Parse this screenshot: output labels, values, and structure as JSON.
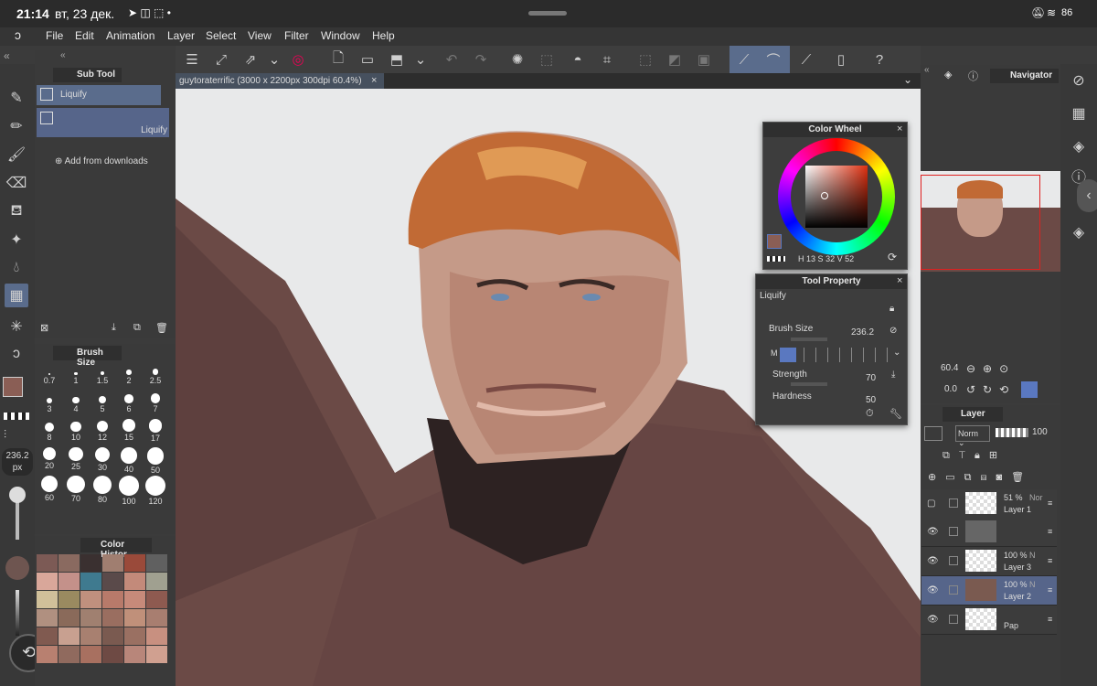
{
  "status": {
    "time": "21:14",
    "date": "вт, 23 дек.",
    "battery": "86"
  },
  "menu": [
    "File",
    "Edit",
    "Animation",
    "Layer",
    "Select",
    "View",
    "Filter",
    "Window",
    "Help"
  ],
  "subtool": {
    "title": "Sub Tool",
    "items": [
      "Liquify",
      "Liquify"
    ],
    "add": "Add from downloads"
  },
  "brush": {
    "title": "Brush Size",
    "sizes": [
      "0.7",
      "1",
      "1.5",
      "2",
      "2.5",
      "3",
      "4",
      "5",
      "6",
      "7",
      "8",
      "10",
      "12",
      "15",
      "17",
      "20",
      "25",
      "30",
      "40",
      "50",
      "60",
      "70",
      "80",
      "100",
      "120"
    ],
    "current": "236.2",
    "unit": "px"
  },
  "history": {
    "title": "Color Histor",
    "colors": [
      "#7c5a55",
      "#8a6a60",
      "#3a3030",
      "#a07e70",
      "#9a4a3a",
      "#606060",
      "#d9a79a",
      "#c4918a",
      "#3f7a8f",
      "#5a4a4a",
      "#c38a7a",
      "#a0a090",
      "#d0c09a",
      "#9a8a60",
      "#c0907e",
      "#b87a6a",
      "#c78a7a",
      "#8e5a50",
      "#b09080",
      "#8a6a5a",
      "#a08070",
      "#9a6e60",
      "#c0907a",
      "#a87e70",
      "#805a50",
      "#c8a090",
      "#a88070",
      "#7a5a50",
      "#9a7062",
      "#c89080",
      "#b88070",
      "#906a5e",
      "#a87060",
      "#6e4a44",
      "#b8867a",
      "#d0a090"
    ]
  },
  "canvas": {
    "tab": "guytoraterrific (3000 x 2200px 300dpi 60.4%)"
  },
  "colorwheel": {
    "title": "Color Wheel",
    "h": "13",
    "s": "32",
    "v": "52",
    "h_label": "H",
    "s_label": "S",
    "v_label": "V"
  },
  "toolprop": {
    "title": "Tool Property",
    "tool": "Liquify",
    "brush_label": "Brush Size",
    "brush_value": "236.2",
    "mode_label": "M",
    "strength_label": "Strength",
    "strength_value": "70",
    "hardness_label": "Hardness",
    "hardness_value": "50"
  },
  "navigator": {
    "title": "Navigator",
    "zoom": "60.4",
    "angle": "0.0"
  },
  "layer": {
    "title": "Layer",
    "blend": "Norm",
    "opacity": "100",
    "rows": [
      {
        "pct": "51 %",
        "mode": "Nor",
        "name": "Layer 1"
      },
      {
        "pct": "",
        "mode": "",
        "name": ""
      },
      {
        "pct": "100 %",
        "mode": "N",
        "name": "Layer 3"
      },
      {
        "pct": "100 %",
        "mode": "N",
        "name": "Layer 2"
      },
      {
        "pct": "",
        "mode": "",
        "name": "Pap"
      }
    ]
  },
  "colors": {
    "main": "#8a5e55",
    "accent": "#5a78c0"
  }
}
